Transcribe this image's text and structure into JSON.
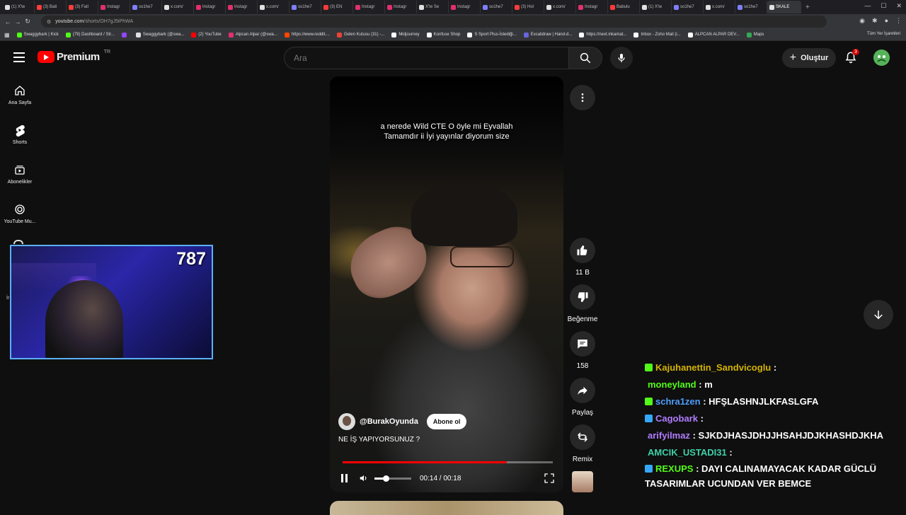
{
  "browser": {
    "tabs": [
      {
        "label": "(1) X'te",
        "color": "#e0e0e0"
      },
      {
        "label": "(3) Bati",
        "color": "#ff3b3b"
      },
      {
        "label": "(3) Fatl",
        "color": "#ff3b3b"
      },
      {
        "label": "Instagr",
        "color": "#e1306c"
      },
      {
        "label": "so1he7",
        "color": "#7e7eff"
      },
      {
        "label": "x.com/",
        "color": "#e0e0e0"
      },
      {
        "label": "Instagr",
        "color": "#e1306c"
      },
      {
        "label": "Instagr",
        "color": "#e1306c"
      },
      {
        "label": "x.com/",
        "color": "#e0e0e0"
      },
      {
        "label": "so1he7",
        "color": "#7e7eff"
      },
      {
        "label": "(3) EN",
        "color": "#ff3b3b"
      },
      {
        "label": "Instagr",
        "color": "#e1306c"
      },
      {
        "label": "Instagr",
        "color": "#e1306c"
      },
      {
        "label": "X'te Se",
        "color": "#e0e0e0"
      },
      {
        "label": "Instagr",
        "color": "#e1306c"
      },
      {
        "label": "so1he7",
        "color": "#7e7eff"
      },
      {
        "label": "(3) Hol",
        "color": "#ff3b3b"
      },
      {
        "label": "x.com/",
        "color": "#e0e0e0"
      },
      {
        "label": "Instagr",
        "color": "#e1306c"
      },
      {
        "label": "Babulu",
        "color": "#ff3b3b"
      },
      {
        "label": "(1) X'te",
        "color": "#e0e0e0"
      },
      {
        "label": "so1he7",
        "color": "#7e7eff"
      },
      {
        "label": "x.com/",
        "color": "#e0e0e0"
      },
      {
        "label": "so1he7",
        "color": "#7e7eff"
      },
      {
        "label": "SKALE",
        "color": "#e0e0e0"
      }
    ],
    "url_domain": "youtube.com",
    "url_path": "/shorts/OH7gJ5iPhWA",
    "bookmarks": [
      {
        "label": "Swaggybark | Kick",
        "color": "#53fc18"
      },
      {
        "label": "(79) Dashboard / Str...",
        "color": "#53fc18"
      },
      {
        "label": "",
        "color": "#9146ff"
      },
      {
        "label": "Swaggybark (@swa...",
        "color": "#e0e0e0"
      },
      {
        "label": "(2) YouTube",
        "color": "#ff0000"
      },
      {
        "label": "Alpcan Alpar (@swa...",
        "color": "#e1306c"
      },
      {
        "label": "https://www.reddit....",
        "color": "#ff4500"
      },
      {
        "label": "Gelen Kutusu (31) -...",
        "color": "#ea4335"
      },
      {
        "label": "Midjourney",
        "color": "#ffffff"
      },
      {
        "label": "Konfuse Shop",
        "color": "#ffffff"
      },
      {
        "label": "S Sport Plus-İstediği...",
        "color": "#ffffff"
      },
      {
        "label": "Excalidraw | Hand-d...",
        "color": "#6965db"
      },
      {
        "label": "https://next.inkamat...",
        "color": "#ffffff"
      },
      {
        "label": "Inbox - Zoho Mail (i...",
        "color": "#ffffff"
      },
      {
        "label": "ALPCAN ALPAR DEV...",
        "color": "#ffffff"
      },
      {
        "label": "Maps",
        "color": "#34a853"
      }
    ],
    "bookmarks_all": "Tüm Yer İşaretleri"
  },
  "header": {
    "logo_text": "Premium",
    "logo_region": "TR",
    "search_placeholder": "Ara",
    "create_label": "Oluştur",
    "notification_count": "3"
  },
  "sidebar": {
    "items": [
      {
        "label": "Ana Sayfa",
        "icon": "home-icon"
      },
      {
        "label": "Shorts",
        "icon": "shorts-icon"
      },
      {
        "label": "Abonelikler",
        "icon": "subscriptions-icon"
      },
      {
        "label": "YouTube Mu...",
        "icon": "youtube-music-icon"
      }
    ],
    "fragment_label": "İr"
  },
  "overlay": {
    "counter": "787"
  },
  "short": {
    "caption_line1": "a nerede Wild CTE O öyle mi Eyvallah",
    "caption_line2": "Tamamdır ii İyi yayınlar diyorum size",
    "channel": "@BurakOyunda",
    "subscribe_label": "Abone ol",
    "title": "NE İŞ YAPIYORSUNUZ ?",
    "time_current": "00:14",
    "time_total": "00:18",
    "progress": 0.78,
    "volume": 0.3
  },
  "actions": {
    "like_count": "11 B",
    "dislike_label": "Beğenme",
    "comment_count": "158",
    "share_label": "Paylaş",
    "remix_label": "Remix"
  },
  "chat": [
    {
      "user": "Kajuhanettin_Sandvicoglu",
      "sep": " : ",
      "msg": "︎ ︎ ︎ ︎ ︎ ︎ ︎ ︎ ︎ ︎ ︎ ︎ ︎ ︎",
      "color": "#d4b300",
      "badge": "#53fc18"
    },
    {
      "user": "moneyland",
      "sep": " : ",
      "msg": "m",
      "color": "#53fc18",
      "badge": ""
    },
    {
      "user": "schra1zen",
      "sep": " : ",
      "msg": "HFŞLASHNJLKFASLGFA",
      "color": "#4d9dff",
      "badge": "#53fc18"
    },
    {
      "user": "Cagobark",
      "sep": " : ",
      "msg": "",
      "color": "#b07cff",
      "badge": "#34a8ff"
    },
    {
      "user": "arifyilmaz",
      "sep": " : ",
      "msg": "SJKDJHASJDHJJHSAHJDJKHASHDJKHA",
      "color": "#b07cff",
      "badge": ""
    },
    {
      "user": "AMCIK_USTADI31",
      "sep": " : ",
      "msg": "",
      "color": "#3fd1a6",
      "badge": ""
    },
    {
      "user": "REXUPS",
      "sep": " : ",
      "msg": "DAYI CALINAMAYACAK KADAR GÜCLÜ TASARIMLAR UCUNDAN VER BEMCE",
      "color": "#53fc18",
      "badge": "#34a8ff"
    }
  ]
}
